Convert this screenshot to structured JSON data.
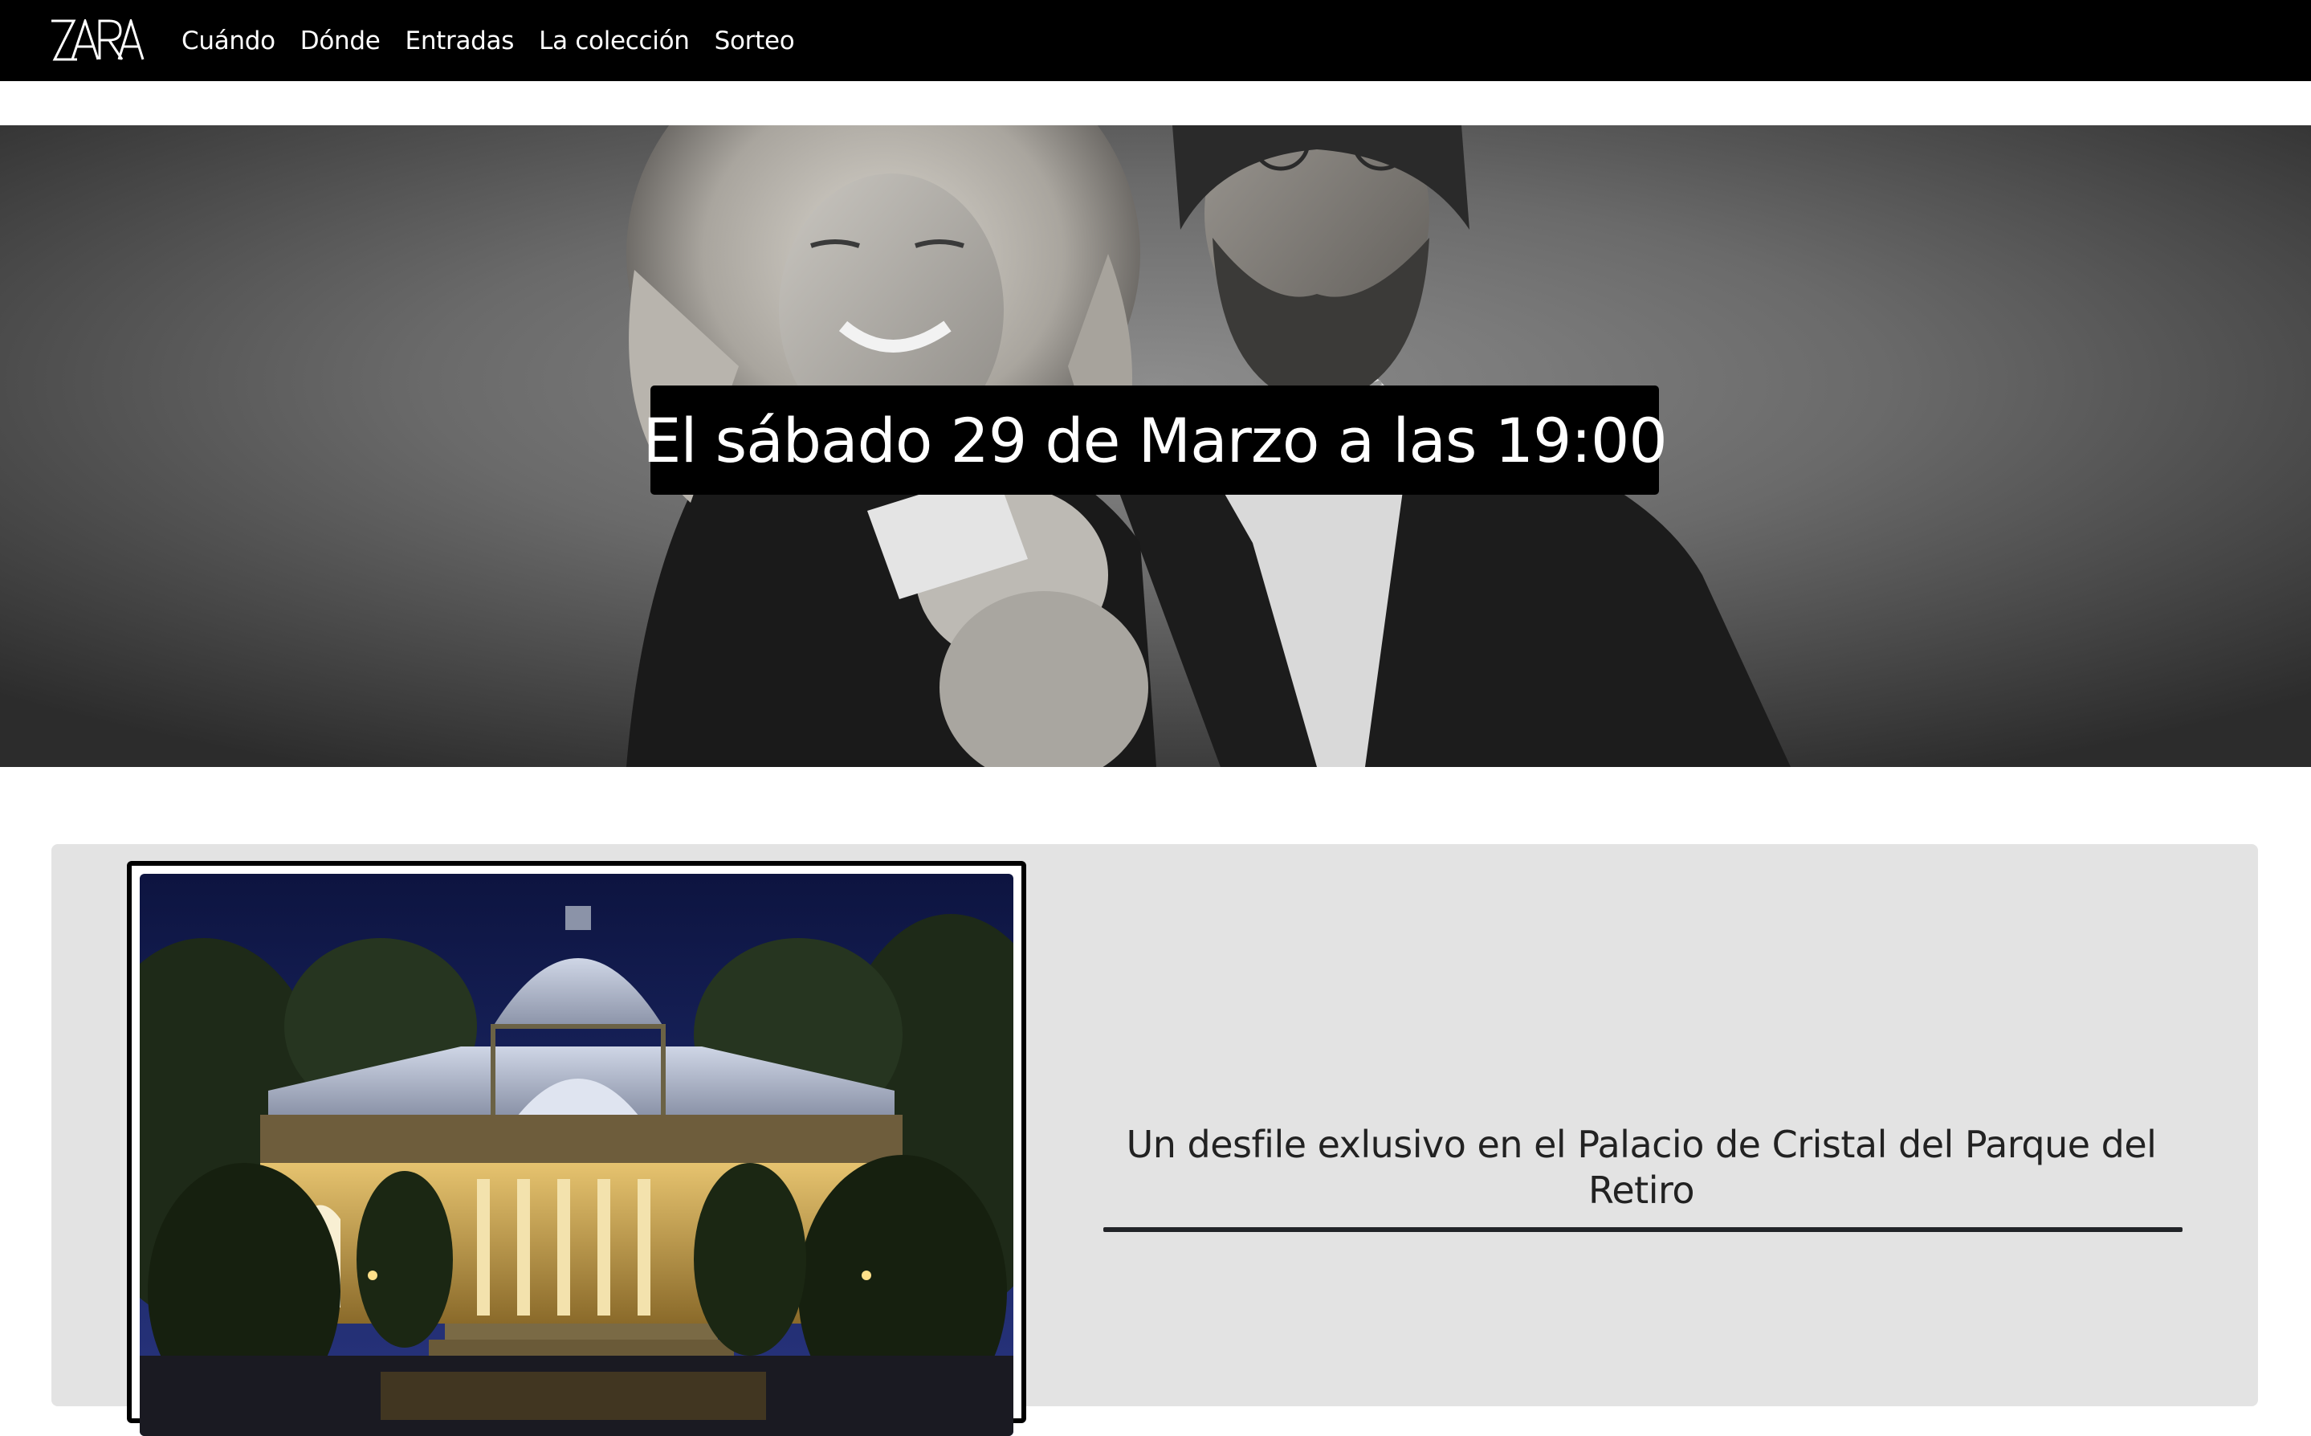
{
  "nav": {
    "logo_text": "ZARA",
    "links": [
      "Cuándo",
      "Dónde",
      "Entradas",
      "La colección",
      "Sorteo"
    ]
  },
  "hero": {
    "caption": "El sábado 29 de Marzo a las 19:00",
    "image": "black-and-white-couple-portrait"
  },
  "venue": {
    "image": "palacio-de-cristal-night-photo",
    "description": "Un desfile exlusivo en el Palacio de Cristal del Parque del Retiro"
  },
  "colors": {
    "navbar_bg": "#000000",
    "nav_text": "#ffffff",
    "caption_bg": "#000000",
    "section_bg": "#e3e3e3",
    "rule": "#222428"
  }
}
